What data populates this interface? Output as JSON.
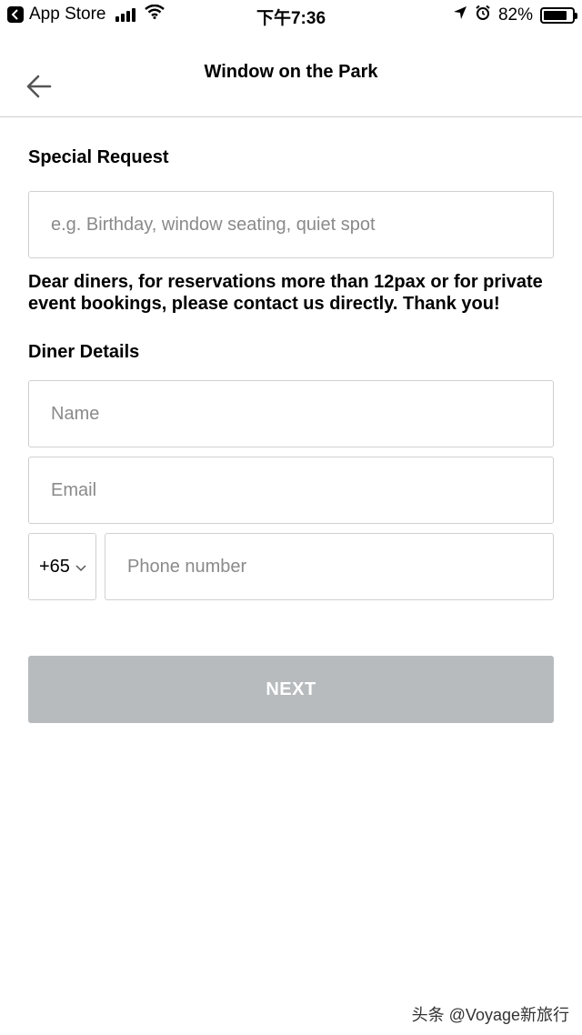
{
  "status_bar": {
    "back_app": "App Store",
    "time": "下午7:36",
    "battery_percent": "82%",
    "battery_level": 0.82,
    "icons": [
      "back-chevron-icon",
      "signal-icon",
      "wifi-icon",
      "location-arrow-icon",
      "alarm-icon",
      "battery-icon"
    ]
  },
  "header": {
    "title": "Window on the Park",
    "back_icon": "arrow-left-icon"
  },
  "special_request": {
    "title": "Special Request",
    "placeholder": "e.g. Birthday, window seating, quiet spot",
    "value": ""
  },
  "notice": "Dear diners, for reservations more than 12pax or for private event bookings, please contact us directly. Thank you!",
  "diner_details": {
    "title": "Diner Details",
    "name_placeholder": "Name",
    "email_placeholder": "Email",
    "country_code": "+65",
    "phone_placeholder": "Phone number"
  },
  "next_button": "NEXT",
  "colors": {
    "button_disabled": "#b7bbbe",
    "border": "#d0d0d0",
    "placeholder": "#8a8a8a"
  },
  "watermark": "头条 @Voyage新旅行"
}
